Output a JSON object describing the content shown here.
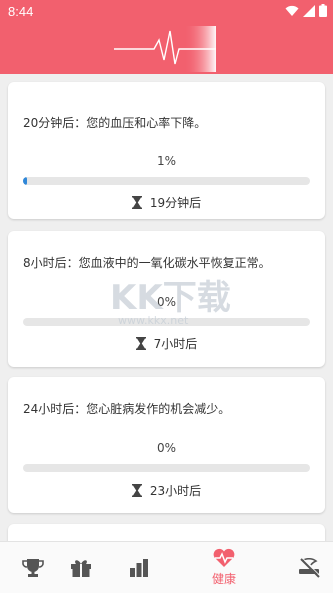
{
  "statusbar": {
    "time": "8:44"
  },
  "colors": {
    "accent": "#f2606e",
    "progress": "#2f87d8"
  },
  "cards": [
    {
      "title": "20分钟后：您的血压和心率下降。",
      "percent": "1%",
      "progress": 0.01,
      "eta": "19分钟后"
    },
    {
      "title": "8小时后：您血液中的一氧化碳水平恢复正常。",
      "percent": "0%",
      "progress": 0,
      "eta": "7小时后"
    },
    {
      "title": "24小时后：您心脏病发作的机会减少。",
      "percent": "0%",
      "progress": 0,
      "eta": "23小时后"
    }
  ],
  "watermark": {
    "main": "KK下载",
    "url": "www.kkx.net"
  },
  "nav": {
    "items": [
      {
        "icon": "trophy-icon"
      },
      {
        "icon": "gift-icon"
      },
      {
        "icon": "bar-chart-icon"
      },
      {
        "icon": "heart-pulse-icon",
        "label": "健康"
      },
      {
        "icon": "no-smoking-icon"
      }
    ]
  }
}
